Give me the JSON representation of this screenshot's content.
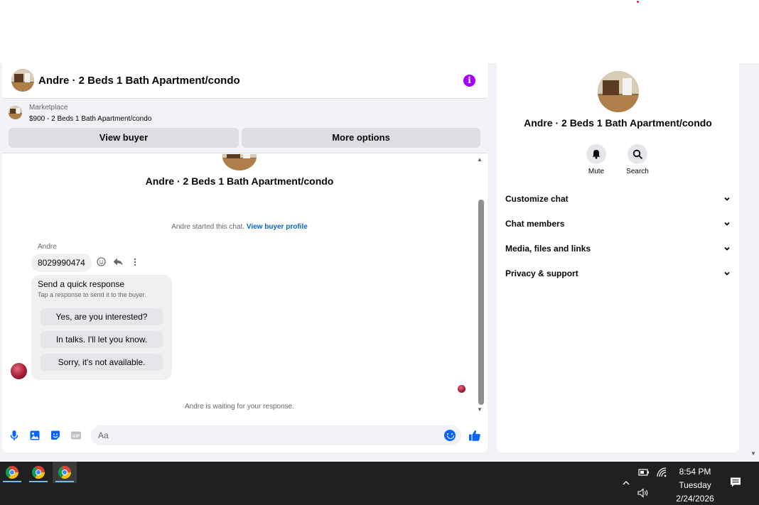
{
  "chat": {
    "title": "Andre · 2 Beds 1 Bath Apartment/condo",
    "info_icon": "i",
    "marketplace_label": "Marketplace",
    "listing": "$900 - 2 Beds 1 Bath Apartment/condo",
    "view_buyer": "View buyer",
    "more_options": "More options",
    "center_title": "Andre · 2 Beds 1 Bath Apartment/condo",
    "started_text": "Andre started this chat.",
    "started_link": "View buyer profile",
    "sender_name": "Andre",
    "message": "8029990474",
    "quick_response": {
      "title": "Send a quick response",
      "subtitle": "Tap a response to send it to the buyer.",
      "options": [
        "Yes, are you interested?",
        "In talks. I'll let you know.",
        "Sorry, it's not available."
      ]
    },
    "waiting": "Andre is waiting for your response.",
    "composer_placeholder": "Aa"
  },
  "details": {
    "title": "Andre · 2 Beds 1 Bath Apartment/condo",
    "mute": "Mute",
    "search": "Search",
    "sections": [
      "Customize chat",
      "Chat members",
      "Media, files and links",
      "Privacy & support"
    ]
  },
  "taskbar": {
    "time": "8:54 PM",
    "day": "Tuesday",
    "date": "2/24/2026"
  },
  "colors": {
    "accent": "#0866ff",
    "info": "#a200ff",
    "link": "#0a66c2"
  }
}
